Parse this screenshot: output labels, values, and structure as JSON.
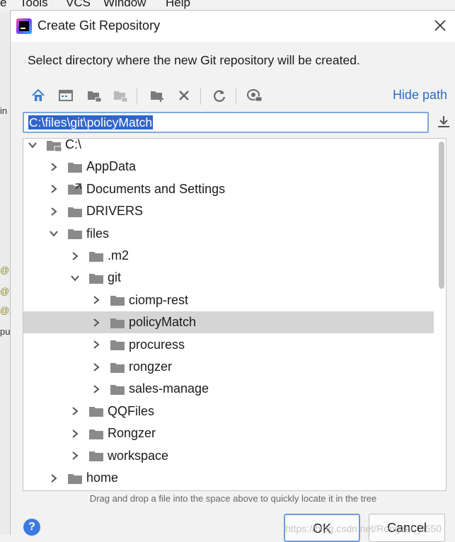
{
  "background": {
    "menu_items": [
      "File",
      "Tools",
      "VCS",
      "Window",
      "Help"
    ],
    "menu_visible": [
      "e",
      "Tools",
      "VCS",
      "Window",
      "Help"
    ],
    "gutter_marks": [
      "in",
      "@I",
      "@T",
      "@A",
      "pu"
    ]
  },
  "dialog": {
    "title": "Create Git Repository",
    "description": "Select directory where the new Git repository will be created.",
    "hide_path_label": "Hide path",
    "path_value": "C:\\files\\git\\policyMatch",
    "hint": "Drag and drop a file into the space above to quickly locate it in the tree",
    "ok_label": "OK",
    "cancel_label": "Cancel",
    "help_label": "?",
    "watermark": "https://blog.csdn.net/Rongzer_0550"
  },
  "toolbar": {
    "icons": [
      "home-icon",
      "desktop-icon",
      "new-folder-icon",
      "folder-collapse-icon",
      "add-folder-icon",
      "delete-icon",
      "refresh-icon",
      "show-hidden-icon"
    ]
  },
  "tree": {
    "rows": [
      {
        "label": "C:\\",
        "depth": 0,
        "expanded": true,
        "drive": true
      },
      {
        "label": "AppData",
        "depth": 1,
        "expanded": false
      },
      {
        "label": "Documents and Settings",
        "depth": 1,
        "expanded": false,
        "link": true
      },
      {
        "label": "DRIVERS",
        "depth": 1,
        "expanded": false
      },
      {
        "label": "files",
        "depth": 1,
        "expanded": true
      },
      {
        "label": ".m2",
        "depth": 2,
        "expanded": false
      },
      {
        "label": "git",
        "depth": 2,
        "expanded": true
      },
      {
        "label": "ciomp-rest",
        "depth": 3,
        "expanded": false
      },
      {
        "label": "policyMatch",
        "depth": 3,
        "expanded": false,
        "selected": true
      },
      {
        "label": "procuress",
        "depth": 3,
        "expanded": false
      },
      {
        "label": "rongzer",
        "depth": 3,
        "expanded": false
      },
      {
        "label": "sales-manage",
        "depth": 3,
        "expanded": false
      },
      {
        "label": "QQFiles",
        "depth": 2,
        "expanded": false
      },
      {
        "label": "Rongzer",
        "depth": 2,
        "expanded": false
      },
      {
        "label": "workspace",
        "depth": 2,
        "expanded": false
      },
      {
        "label": "home",
        "depth": 1,
        "expanded": false
      }
    ]
  }
}
